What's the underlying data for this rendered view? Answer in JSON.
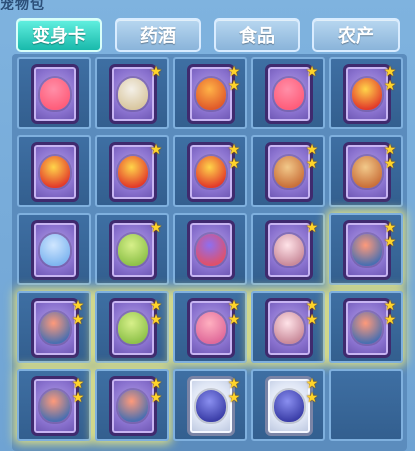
{
  "header": {
    "title_fragment": "宠物包"
  },
  "tabs": [
    {
      "label": "变身卡",
      "active": true
    },
    {
      "label": "药酒",
      "active": false
    },
    {
      "label": "食品",
      "active": false
    },
    {
      "label": "农产",
      "active": false
    }
  ],
  "colors": {
    "tab_active": "#2ad0c0",
    "tab_inactive": "#9fc4e6",
    "slot_bg": "#3a6a9c",
    "card_purple": "#8a72cf",
    "star": "#ffd42a"
  },
  "grid": {
    "columns": 5,
    "rows": 5,
    "slots": [
      {
        "card": "purple",
        "figure": "pink-creature",
        "stars": 0,
        "glow": false
      },
      {
        "card": "purple",
        "figure": "white-fox",
        "stars": 1,
        "glow": false
      },
      {
        "card": "purple",
        "figure": "orange-dragon",
        "stars": 2,
        "glow": false
      },
      {
        "card": "purple",
        "figure": "pink-creature",
        "stars": 1,
        "glow": false
      },
      {
        "card": "purple",
        "figure": "gold-dragon",
        "stars": 2,
        "glow": false
      },
      {
        "card": "purple",
        "figure": "gold-dragon",
        "stars": 0,
        "glow": false
      },
      {
        "card": "purple",
        "figure": "gold-dragon",
        "stars": 1,
        "glow": false
      },
      {
        "card": "purple",
        "figure": "gold-dragon",
        "stars": 2,
        "glow": false
      },
      {
        "card": "purple",
        "figure": "fox-warrior",
        "stars": 2,
        "glow": false
      },
      {
        "card": "purple",
        "figure": "fox-warrior",
        "stars": 2,
        "glow": false
      },
      {
        "card": "purple",
        "figure": "blue-sprite",
        "stars": 0,
        "glow": false
      },
      {
        "card": "purple",
        "figure": "green-spirit",
        "stars": 1,
        "glow": false
      },
      {
        "card": "purple",
        "figure": "bird",
        "stars": 0,
        "glow": false
      },
      {
        "card": "purple",
        "figure": "winged-girl",
        "stars": 1,
        "glow": false
      },
      {
        "card": "purple",
        "figure": "armored-warrior",
        "stars": 2,
        "glow": true
      },
      {
        "card": "purple",
        "figure": "armored-warrior",
        "stars": 2,
        "glow": true
      },
      {
        "card": "purple",
        "figure": "green-spirit",
        "stars": 2,
        "glow": true
      },
      {
        "card": "purple",
        "figure": "pink-warrior",
        "stars": 2,
        "glow": true
      },
      {
        "card": "purple",
        "figure": "winged-girl",
        "stars": 2,
        "glow": true
      },
      {
        "card": "purple",
        "figure": "armored-warrior",
        "stars": 2,
        "glow": true
      },
      {
        "card": "purple",
        "figure": "armored-warrior",
        "stars": 2,
        "glow": true
      },
      {
        "card": "purple",
        "figure": "armored-warrior",
        "stars": 2,
        "glow": true
      },
      {
        "card": "silver",
        "figure": "blue-knight",
        "stars": 2,
        "glow": false
      },
      {
        "card": "silver",
        "figure": "blue-knight",
        "stars": 2,
        "glow": false
      },
      {
        "card": "empty",
        "figure": "",
        "stars": 0,
        "glow": false
      }
    ]
  }
}
